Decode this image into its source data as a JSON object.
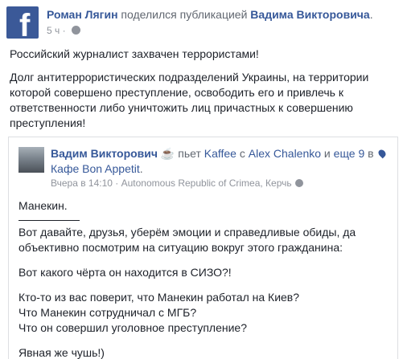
{
  "header": {
    "author": "Роман Лягин",
    "shared_text": " поделился публикацией ",
    "shared_from": "Вадима Викторовича",
    "shared_suffix": ".",
    "time": "5 ч",
    "separator": " · "
  },
  "post": {
    "paragraphs": [
      "Российский журналист захвачен террористами!",
      "Долг антитеррористических подразделений Украины, на территории которой совершено преступление, освободить его и привлечь к ответственности либо уничтожить лиц причастных к совершению преступления!"
    ]
  },
  "shared_post": {
    "author": "Вадим Викторович",
    "emoji": "☕",
    "activity": " пьет ",
    "item": "Kaffee",
    "with": " с ",
    "friend": "Alex Chalenko",
    "and": " и ",
    "others": "еще 9",
    "at": " в ",
    "place": "Кафе Bon Appetit",
    "place_suffix": ".",
    "time": "Вчера в 14:10",
    "location": "Autonomous Republic of Crimea, Керчь",
    "body_lines": [
      "Манекин.",
      "Вот давайте, друзья, уберём эмоции и справедливые обиды, да объективно посмотрим на ситуацию вокруг этого гражданина:",
      "Вот какого чёрта он находится в СИЗО?!",
      "Кто-то из вас поверит, что Манекин работал на Киев?",
      "Что Манекин сотрудничал с МГБ?",
      "Что он совершил уголовное преступление?",
      "Явная же чушь!)"
    ]
  },
  "colors": {
    "link": "#365899",
    "text": "#1d2129",
    "muted": "#90949c",
    "facebook_blue": "#3b5998"
  },
  "icons": [
    "facebook-logo-icon",
    "globe-icon",
    "coffee-icon",
    "location-pin-icon"
  ]
}
